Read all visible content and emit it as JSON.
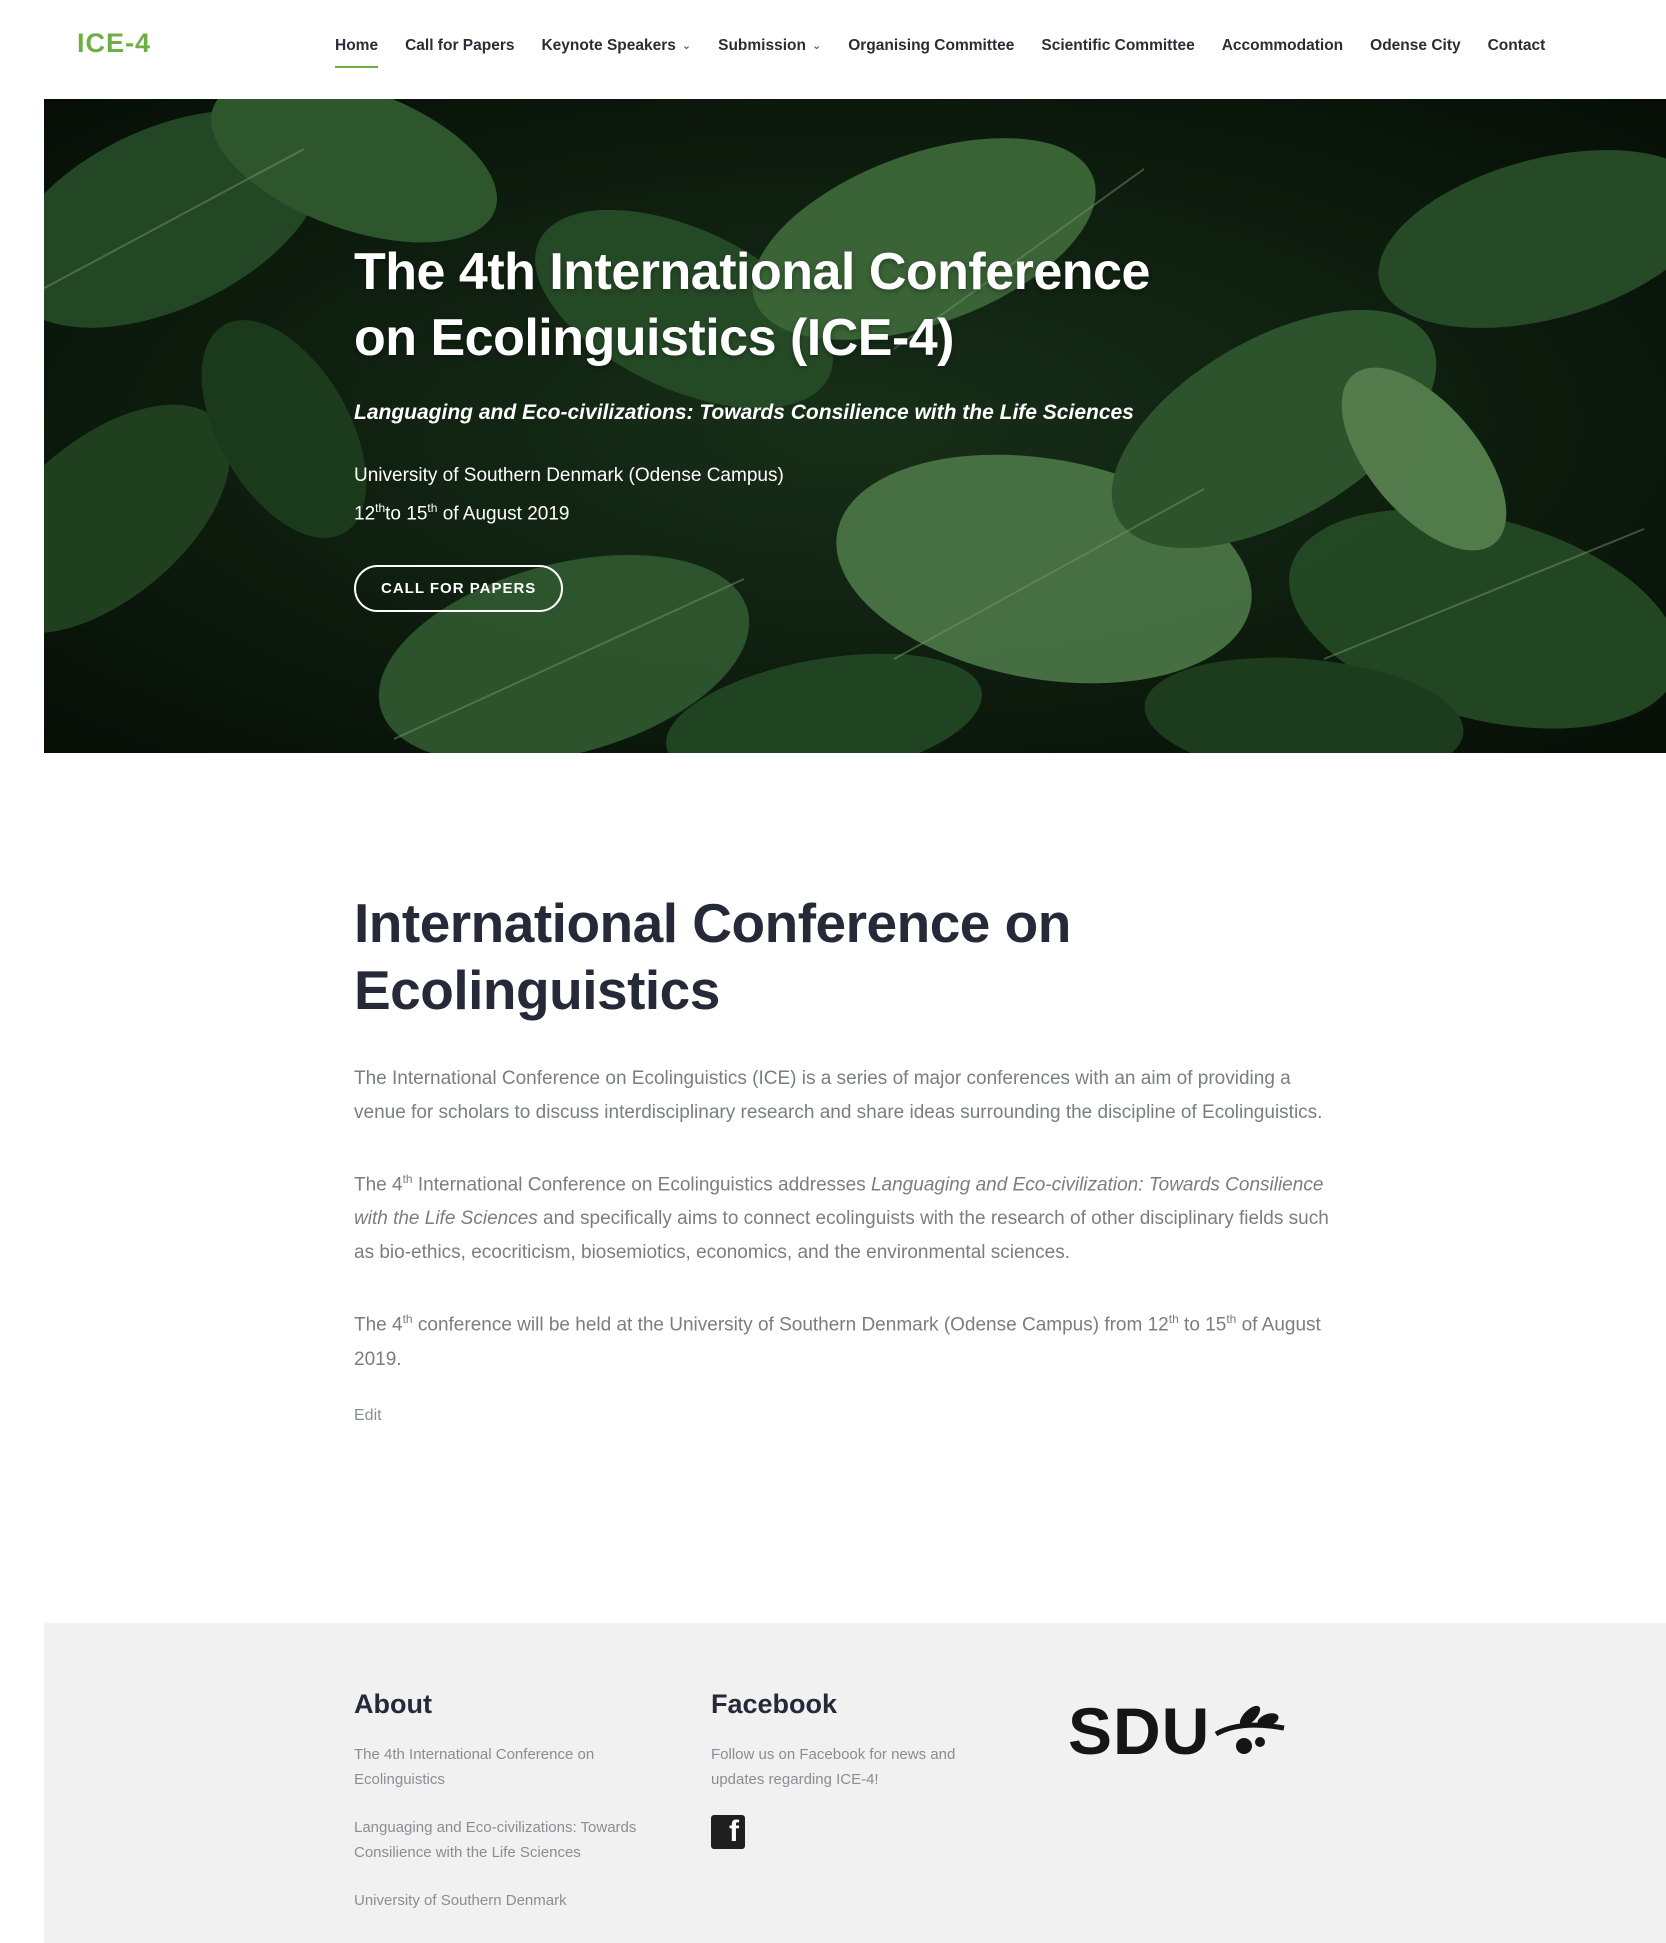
{
  "brand": {
    "logo": "ICE-4",
    "accent": "#6fae44"
  },
  "nav": [
    {
      "label": "Home",
      "active": true,
      "dropdown": false
    },
    {
      "label": "Call for Papers",
      "active": false,
      "dropdown": false
    },
    {
      "label": "Keynote Speakers",
      "active": false,
      "dropdown": true
    },
    {
      "label": "Submission",
      "active": false,
      "dropdown": true
    },
    {
      "label": "Organising Committee",
      "active": false,
      "dropdown": false
    },
    {
      "label": "Scientific Committee",
      "active": false,
      "dropdown": false
    },
    {
      "label": "Accommodation",
      "active": false,
      "dropdown": false
    },
    {
      "label": "Odense City",
      "active": false,
      "dropdown": false
    },
    {
      "label": "Contact",
      "active": false,
      "dropdown": false
    }
  ],
  "hero": {
    "title_line1": "The 4th International Conference",
    "title_line2": "on Ecolinguistics (ICE-4)",
    "subtitle": "Languaging and Eco-civilizations: Towards Consilience with the Life Sciences",
    "location": "University of Southern Denmark (Odense Campus)",
    "date_day1": "12",
    "date_sup1": "th",
    "date_mid": "to 15",
    "date_sup2": "th",
    "date_end": " of August 2019",
    "cta_label": "CALL FOR PAPERS"
  },
  "main": {
    "title": "International Conference on Ecolinguistics",
    "p1": "The International Conference on Ecolinguistics (ICE) is a series of major conferences with an aim of providing a venue for scholars to discuss interdisciplinary research and share ideas surrounding the discipline of Ecolinguistics.",
    "p2_a": "The 4",
    "p2_sup": "th",
    "p2_b": " International Conference on Ecolinguistics addresses ",
    "p2_italic": "Languaging and Eco-civilization: Towards Consilience with the Life Sciences",
    "p2_c": " and specifically aims to connect ecolinguists with the research of other disciplinary fields such as bio-ethics, ecocriticism, biosemiotics, economics, and the environmental sciences.",
    "p3_a": "The 4",
    "p3_sup1": "th",
    "p3_b": " conference will be held at the University of Southern Denmark (Odense Campus) from 12",
    "p3_sup2": "th",
    "p3_c": " to 15",
    "p3_sup3": "th",
    "p3_d": " of August 2019.",
    "edit": "Edit"
  },
  "footer": {
    "about_title": "About",
    "about_p1": "The 4th International Conference on Ecolinguistics",
    "about_p2": "Languaging and Eco-civilizations: Towards Consilience with the Life Sciences",
    "about_p3": "University of Southern Denmark",
    "facebook_title": "Facebook",
    "facebook_text": "Follow us on Facebook for news and updates regarding ICE-4!",
    "facebook_icon": "facebook-icon",
    "sdu_logo": "SDU"
  }
}
